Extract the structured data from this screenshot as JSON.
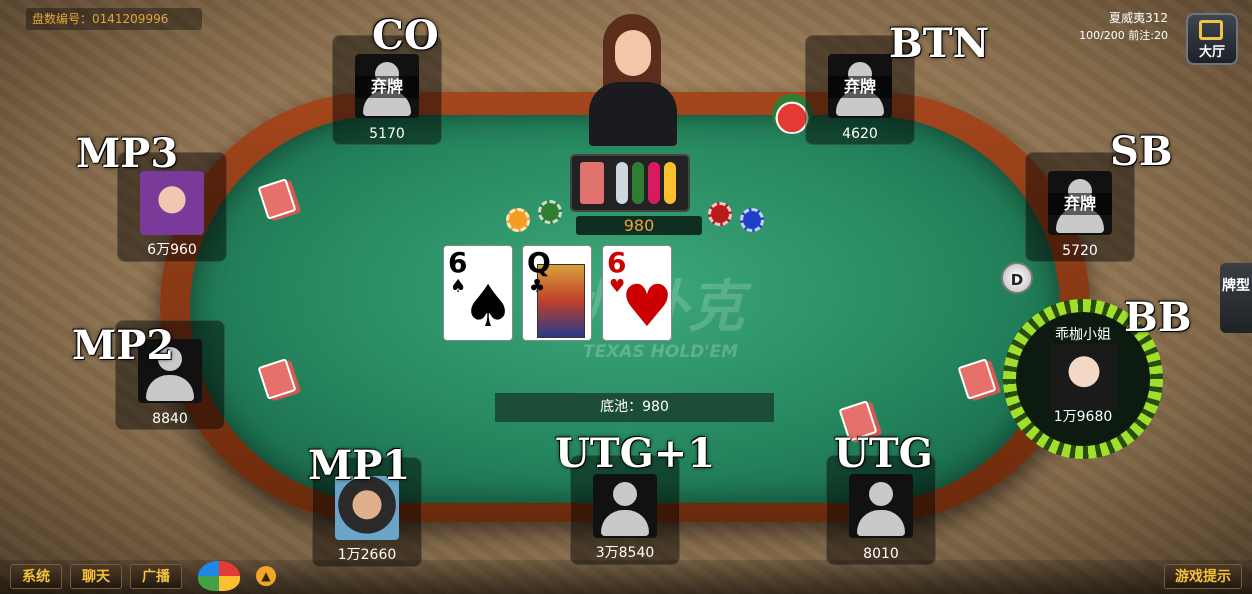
{
  "header": {
    "hand_number_label": "盘数编号：0141209996",
    "player_name": "夏威夷312",
    "blinds_info": "100/200 前注:20",
    "lobby_label": "大厅"
  },
  "table": {
    "pot_center": "980",
    "pot_total_label": "底池：980",
    "logo_text": "德州扑克",
    "logo_subtext": "TEXAS HOLD'EM",
    "dealer_button": "D",
    "side_tab_label": "牌型"
  },
  "community_cards": [
    {
      "rank": "6",
      "suit": "♠",
      "color": "#000000"
    },
    {
      "rank": "Q",
      "suit": "♣",
      "color": "#000000"
    },
    {
      "rank": "6",
      "suit": "♥",
      "color": "#cc0000"
    }
  ],
  "seats": {
    "co": {
      "position": "CO",
      "status": "弃牌",
      "chips": "5170"
    },
    "btn": {
      "position": "BTN",
      "status": "弃牌",
      "chips": "4620"
    },
    "mp3": {
      "position": "MP3",
      "chips": "6万960"
    },
    "sb": {
      "position": "SB",
      "status": "弃牌",
      "chips": "5720"
    },
    "mp2": {
      "position": "MP2",
      "chips": "8840"
    },
    "bb": {
      "position": "BB",
      "name": "乖枷小姐",
      "chips": "1万9680"
    },
    "mp1": {
      "position": "MP1",
      "chips": "1万2660"
    },
    "utg1": {
      "position": "UTG+1",
      "chips": "3万8540"
    },
    "utg": {
      "position": "UTG",
      "chips": "8010"
    }
  },
  "bottom_bar": {
    "system": "系统",
    "chat": "聊天",
    "broadcast": "广播",
    "hint": "游戏提示"
  },
  "colors": {
    "felt": "#25865e",
    "rim": "#8a3814",
    "accent_gold": "#f5c23a",
    "bb_ring": "#9ee02b"
  }
}
